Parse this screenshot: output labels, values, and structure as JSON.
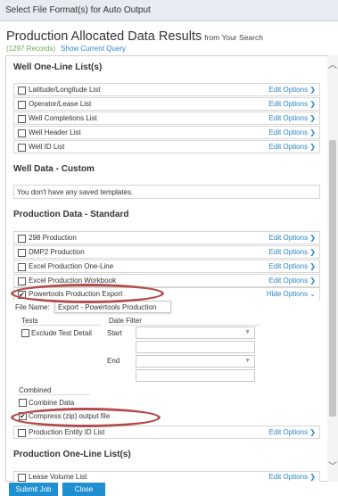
{
  "window": {
    "title": "Select File Format(s) for Auto Output"
  },
  "header": {
    "title": "Production Allocated Data Results",
    "from": "from Your Search",
    "records": "(1297 Records)",
    "show_query": "Show Current Query"
  },
  "sections": {
    "well_one_line": {
      "title": "Well One-Line List(s)",
      "items": [
        {
          "label": "Latitude/Longitude List",
          "action": "Edit Options"
        },
        {
          "label": "Operator/Lease List",
          "action": "Edit Options"
        },
        {
          "label": "Well Completions List",
          "action": "Edit Options"
        },
        {
          "label": "Well Header List",
          "action": "Edit Options"
        },
        {
          "label": "Well ID List",
          "action": "Edit Options"
        }
      ]
    },
    "well_custom": {
      "title": "Well Data - Custom",
      "notice": "You don't have any saved templates."
    },
    "production_standard": {
      "title": "Production Data - Standard",
      "items": [
        {
          "label": "298 Production",
          "action": "Edit Options"
        },
        {
          "label": "DMP2 Production",
          "action": "Edit Options"
        },
        {
          "label": "Excel Production One-Line",
          "action": "Edit Options"
        },
        {
          "label": "Excel Production Workbook",
          "action": "Edit Options"
        },
        {
          "label": "Powertools Production Export",
          "action": "Hide Options"
        }
      ]
    },
    "options": {
      "file_name_label": "File Name:",
      "file_name_value": "Export - Powertools Production",
      "tests_label": "Tests",
      "exclude_test_label": "Exclude Test Detail",
      "date_filter_label": "Date Filter",
      "start_label": "Start",
      "end_label": "End",
      "combined_label": "Combined",
      "combine_data_label": "Combine Data",
      "compress_label": "Compress (zip) output file",
      "check_mark": "✔"
    },
    "production_entity": {
      "label": "Production Entity ID List",
      "action": "Edit Options"
    },
    "production_one_line": {
      "title": "Production One-Line List(s)",
      "items": [
        {
          "label": "Lease Volume List",
          "action": "Edit Options"
        }
      ]
    }
  },
  "footer": {
    "submit": "Submit Job",
    "close": "Close"
  },
  "icons": {
    "chevron_right": "❯",
    "chevron_down": "⌄",
    "scroll_up": "︿",
    "scroll_down": "﹀",
    "dropdown": "▼"
  },
  "colors": {
    "link": "#2a86c6",
    "button": "#1f8fd1",
    "records": "#6aa84f",
    "annotation": "#b44a4a"
  }
}
